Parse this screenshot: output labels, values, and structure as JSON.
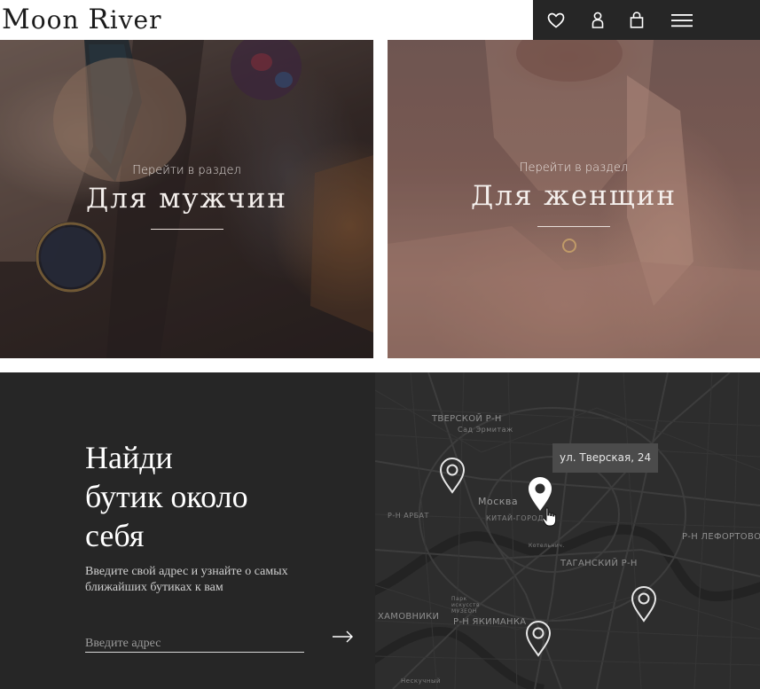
{
  "header": {
    "logo": {
      "first_initial": "M",
      "first_rest": "oon",
      "second_initial": "R",
      "second_rest": "iver",
      "accent_color": "#c9a45a"
    },
    "icons": [
      "heart-icon",
      "user-icon",
      "bag-icon",
      "menu-icon"
    ],
    "toolbar_color": "#262626"
  },
  "tiles": {
    "men": {
      "subtitle": "Перейти в раздел",
      "title": "Для мужчин"
    },
    "women": {
      "subtitle": "Перейти в раздел",
      "title": "Для женщин"
    }
  },
  "finder": {
    "title_lines": [
      "Найди",
      "бутик около",
      "себя"
    ],
    "description": "Введите свой адрес и узнайте о самых ближайших бутиках к вам",
    "address_placeholder": "Введите адрес",
    "address_value": "",
    "submit_icon": "arrow-right-icon",
    "background_color": "#262626"
  },
  "map": {
    "tooltip": "ул. Тверская, 24",
    "labels": {
      "tverskoy": "ТВЕРСКОЙ Р-Н",
      "sad_ermitazh": "Сад Эрмитаж",
      "moskva": "Москва",
      "kitay_gorod": "КИТАЙ-ГОРОД",
      "arbat": "Р-Н АРБАТ",
      "lefortovo": "Р-Н ЛЕФОРТОВО",
      "taganskiy": "ТАГАНСКИЙ Р-Н",
      "khamovniki": "ХАМОВНИКИ",
      "yakimanka": "Р-Н ЯКИМАНКА",
      "park": "Парк искусств МУЗЕОН",
      "neskuchny": "Нескучный",
      "kotelnich": "Котельнич."
    },
    "pins": [
      "pin-outline",
      "pin-selected",
      "pin-outline",
      "pin-outline"
    ]
  }
}
